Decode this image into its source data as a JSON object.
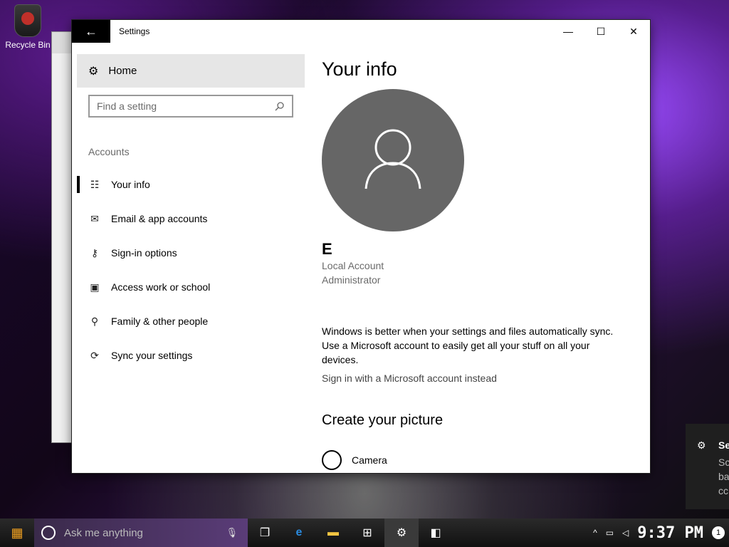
{
  "desktop": {
    "recycle_bin_label": "Recycle Bin"
  },
  "window": {
    "title": "Settings",
    "back_glyph": "←",
    "minimize_glyph": "—",
    "maximize_glyph": "☐",
    "close_glyph": "✕"
  },
  "sidebar": {
    "home_label": "Home",
    "home_icon": "gear-icon",
    "search_placeholder": "Find a setting",
    "section_label": "Accounts",
    "items": [
      {
        "label": "Your info",
        "icon": "person-card-icon",
        "selected": true
      },
      {
        "label": "Email & app accounts",
        "icon": "mail-icon"
      },
      {
        "label": "Sign-in options",
        "icon": "key-icon"
      },
      {
        "label": "Access work or school",
        "icon": "briefcase-icon"
      },
      {
        "label": "Family & other people",
        "icon": "person-add-icon"
      },
      {
        "label": "Sync your settings",
        "icon": "sync-icon"
      }
    ]
  },
  "content": {
    "title": "Your info",
    "user_name": "E",
    "account_type": "Local Account",
    "account_role": "Administrator",
    "message": "Windows is better when your settings and files automatically sync. Use a Microsoft account to easily get all your stuff on all your devices.",
    "ms_link": "Sign in with a Microsoft account instead",
    "create_picture_heading": "Create your picture",
    "camera_label": "Camera"
  },
  "toast": {
    "title": "Se",
    "line1": "Sc",
    "line2": "ba",
    "line3": "cc"
  },
  "taskbar": {
    "search_placeholder": "Ask me anything",
    "clock": "9:37 PM",
    "notification_count": "1"
  },
  "colors": {
    "accent": "#000000",
    "hover": "#e6e6e6",
    "secondary_text": "#6a6a6a"
  }
}
